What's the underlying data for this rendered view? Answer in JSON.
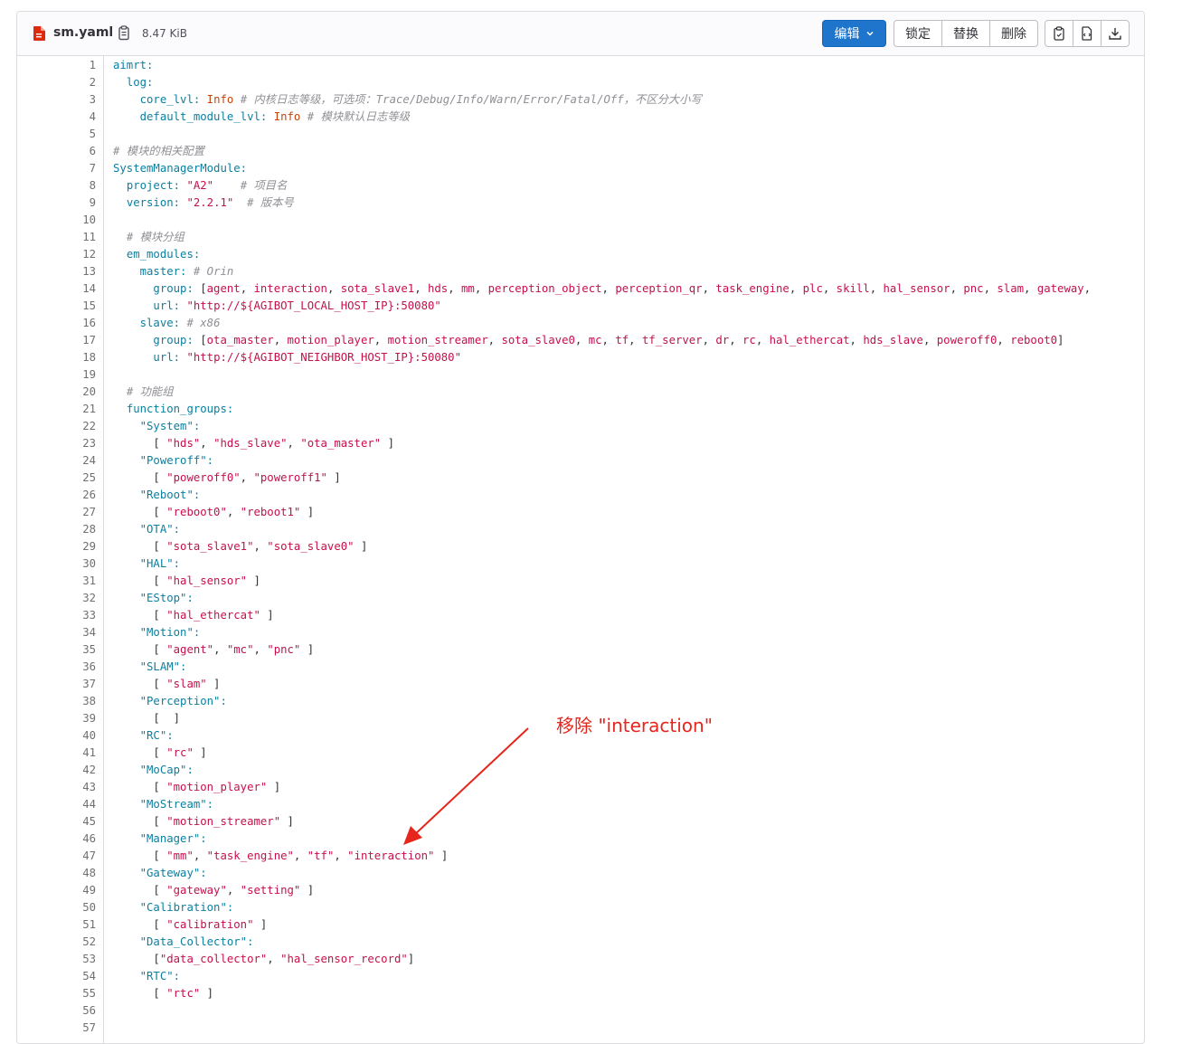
{
  "header": {
    "file_name": "sm.yaml",
    "file_size": "8.47 KiB",
    "file_icon": "yaml-file-icon",
    "copy_icon": "copy-path-icon"
  },
  "toolbar": {
    "edit_label": "编辑",
    "lock_label": "锁定",
    "replace_label": "替换",
    "delete_label": "删除",
    "icons": [
      "copy-contents-icon",
      "open-raw-icon",
      "download-icon"
    ],
    "edit_color": "#1f75cb"
  },
  "code_lines": [
    [
      {
        "t": "aimrt:",
        "c": "k"
      }
    ],
    [
      {
        "t": "  "
      },
      {
        "t": "log:",
        "c": "k"
      }
    ],
    [
      {
        "t": "    "
      },
      {
        "t": "core_lvl:",
        "c": "k"
      },
      {
        "t": " "
      },
      {
        "t": "Info",
        "c": "v"
      },
      {
        "t": " "
      },
      {
        "t": "# 内核日志等级，可选项：Trace/Debug/Info/Warn/Error/Fatal/Off，不区分大小写",
        "c": "c"
      }
    ],
    [
      {
        "t": "    "
      },
      {
        "t": "default_module_lvl:",
        "c": "k"
      },
      {
        "t": " "
      },
      {
        "t": "Info",
        "c": "v"
      },
      {
        "t": " "
      },
      {
        "t": "# 模块默认日志等级",
        "c": "c"
      }
    ],
    [],
    [
      {
        "t": "# 模块的相关配置",
        "c": "c"
      }
    ],
    [
      {
        "t": "SystemManagerModule:",
        "c": "k"
      }
    ],
    [
      {
        "t": "  "
      },
      {
        "t": "project:",
        "c": "k"
      },
      {
        "t": " "
      },
      {
        "t": "\"A2\"",
        "c": "s"
      },
      {
        "t": "    "
      },
      {
        "t": "# 项目名",
        "c": "c"
      }
    ],
    [
      {
        "t": "  "
      },
      {
        "t": "version:",
        "c": "k"
      },
      {
        "t": " "
      },
      {
        "t": "\"2.2.1\"",
        "c": "s"
      },
      {
        "t": "  "
      },
      {
        "t": "# 版本号",
        "c": "c"
      }
    ],
    [],
    [
      {
        "t": "  "
      },
      {
        "t": "# 模块分组",
        "c": "c"
      }
    ],
    [
      {
        "t": "  "
      },
      {
        "t": "em_modules:",
        "c": "k"
      }
    ],
    [
      {
        "t": "    "
      },
      {
        "t": "master:",
        "c": "k"
      },
      {
        "t": " "
      },
      {
        "t": "# Orin",
        "c": "c"
      }
    ],
    [
      {
        "t": "      "
      },
      {
        "t": "group:",
        "c": "k"
      },
      {
        "t": " ["
      },
      {
        "t": "agent",
        "c": "s"
      },
      {
        "t": ", "
      },
      {
        "t": "interaction",
        "c": "s"
      },
      {
        "t": ", "
      },
      {
        "t": "sota_slave1",
        "c": "s"
      },
      {
        "t": ", "
      },
      {
        "t": "hds",
        "c": "s"
      },
      {
        "t": ", "
      },
      {
        "t": "mm",
        "c": "s"
      },
      {
        "t": ", "
      },
      {
        "t": "perception_object",
        "c": "s"
      },
      {
        "t": ", "
      },
      {
        "t": "perception_qr",
        "c": "s"
      },
      {
        "t": ", "
      },
      {
        "t": "task_engine",
        "c": "s"
      },
      {
        "t": ", "
      },
      {
        "t": "plc",
        "c": "s"
      },
      {
        "t": ", "
      },
      {
        "t": "skill",
        "c": "s"
      },
      {
        "t": ", "
      },
      {
        "t": "hal_sensor",
        "c": "s"
      },
      {
        "t": ", "
      },
      {
        "t": "pnc",
        "c": "s"
      },
      {
        "t": ", "
      },
      {
        "t": "slam",
        "c": "s"
      },
      {
        "t": ", "
      },
      {
        "t": "gateway",
        "c": "s"
      },
      {
        "t": ","
      }
    ],
    [
      {
        "t": "      "
      },
      {
        "t": "url:",
        "c": "k"
      },
      {
        "t": " "
      },
      {
        "t": "\"http://${AGIBOT_LOCAL_HOST_IP}:50080\"",
        "c": "s"
      }
    ],
    [
      {
        "t": "    "
      },
      {
        "t": "slave:",
        "c": "k"
      },
      {
        "t": " "
      },
      {
        "t": "# x86",
        "c": "c"
      }
    ],
    [
      {
        "t": "      "
      },
      {
        "t": "group:",
        "c": "k"
      },
      {
        "t": " ["
      },
      {
        "t": "ota_master",
        "c": "s"
      },
      {
        "t": ", "
      },
      {
        "t": "motion_player",
        "c": "s"
      },
      {
        "t": ", "
      },
      {
        "t": "motion_streamer",
        "c": "s"
      },
      {
        "t": ", "
      },
      {
        "t": "sota_slave0",
        "c": "s"
      },
      {
        "t": ", "
      },
      {
        "t": "mc",
        "c": "s"
      },
      {
        "t": ", "
      },
      {
        "t": "tf",
        "c": "s"
      },
      {
        "t": ", "
      },
      {
        "t": "tf_server",
        "c": "s"
      },
      {
        "t": ", "
      },
      {
        "t": "dr",
        "c": "s"
      },
      {
        "t": ", "
      },
      {
        "t": "rc",
        "c": "s"
      },
      {
        "t": ", "
      },
      {
        "t": "hal_ethercat",
        "c": "s"
      },
      {
        "t": ", "
      },
      {
        "t": "hds_slave",
        "c": "s"
      },
      {
        "t": ", "
      },
      {
        "t": "poweroff0",
        "c": "s"
      },
      {
        "t": ", "
      },
      {
        "t": "reboot0",
        "c": "s"
      },
      {
        "t": "]"
      }
    ],
    [
      {
        "t": "      "
      },
      {
        "t": "url:",
        "c": "k"
      },
      {
        "t": " "
      },
      {
        "t": "\"http://${AGIBOT_NEIGHBOR_HOST_IP}:50080\"",
        "c": "s"
      }
    ],
    [],
    [
      {
        "t": "  "
      },
      {
        "t": "# 功能组",
        "c": "c"
      }
    ],
    [
      {
        "t": "  "
      },
      {
        "t": "function_groups:",
        "c": "k"
      }
    ],
    [
      {
        "t": "    "
      },
      {
        "t": "\"System\":",
        "c": "k"
      }
    ],
    [
      {
        "t": "      [ "
      },
      {
        "t": "\"hds\"",
        "c": "s"
      },
      {
        "t": ", "
      },
      {
        "t": "\"hds_slave\"",
        "c": "s"
      },
      {
        "t": ", "
      },
      {
        "t": "\"ota_master\"",
        "c": "s"
      },
      {
        "t": " ]"
      }
    ],
    [
      {
        "t": "    "
      },
      {
        "t": "\"Poweroff\":",
        "c": "k"
      }
    ],
    [
      {
        "t": "      [ "
      },
      {
        "t": "\"poweroff0\"",
        "c": "s"
      },
      {
        "t": ", "
      },
      {
        "t": "\"poweroff1\"",
        "c": "s"
      },
      {
        "t": " ]"
      }
    ],
    [
      {
        "t": "    "
      },
      {
        "t": "\"Reboot\":",
        "c": "k"
      }
    ],
    [
      {
        "t": "      [ "
      },
      {
        "t": "\"reboot0\"",
        "c": "s"
      },
      {
        "t": ", "
      },
      {
        "t": "\"reboot1\"",
        "c": "s"
      },
      {
        "t": " ]"
      }
    ],
    [
      {
        "t": "    "
      },
      {
        "t": "\"OTA\":",
        "c": "k"
      }
    ],
    [
      {
        "t": "      [ "
      },
      {
        "t": "\"sota_slave1\"",
        "c": "s"
      },
      {
        "t": ", "
      },
      {
        "t": "\"sota_slave0\"",
        "c": "s"
      },
      {
        "t": " ]"
      }
    ],
    [
      {
        "t": "    "
      },
      {
        "t": "\"HAL\":",
        "c": "k"
      }
    ],
    [
      {
        "t": "      [ "
      },
      {
        "t": "\"hal_sensor\"",
        "c": "s"
      },
      {
        "t": " ]"
      }
    ],
    [
      {
        "t": "    "
      },
      {
        "t": "\"EStop\":",
        "c": "k"
      }
    ],
    [
      {
        "t": "      [ "
      },
      {
        "t": "\"hal_ethercat\"",
        "c": "s"
      },
      {
        "t": " ]"
      }
    ],
    [
      {
        "t": "    "
      },
      {
        "t": "\"Motion\":",
        "c": "k"
      }
    ],
    [
      {
        "t": "      [ "
      },
      {
        "t": "\"agent\"",
        "c": "s"
      },
      {
        "t": ", "
      },
      {
        "t": "\"mc\"",
        "c": "s"
      },
      {
        "t": ", "
      },
      {
        "t": "\"pnc\"",
        "c": "s"
      },
      {
        "t": " ]"
      }
    ],
    [
      {
        "t": "    "
      },
      {
        "t": "\"SLAM\":",
        "c": "k"
      }
    ],
    [
      {
        "t": "      [ "
      },
      {
        "t": "\"slam\"",
        "c": "s"
      },
      {
        "t": " ]"
      }
    ],
    [
      {
        "t": "    "
      },
      {
        "t": "\"Perception\":",
        "c": "k"
      }
    ],
    [
      {
        "t": "      [  ]"
      }
    ],
    [
      {
        "t": "    "
      },
      {
        "t": "\"RC\":",
        "c": "k"
      }
    ],
    [
      {
        "t": "      [ "
      },
      {
        "t": "\"rc\"",
        "c": "s"
      },
      {
        "t": " ]"
      }
    ],
    [
      {
        "t": "    "
      },
      {
        "t": "\"MoCap\":",
        "c": "k"
      }
    ],
    [
      {
        "t": "      [ "
      },
      {
        "t": "\"motion_player\"",
        "c": "s"
      },
      {
        "t": " ]"
      }
    ],
    [
      {
        "t": "    "
      },
      {
        "t": "\"MoStream\":",
        "c": "k"
      }
    ],
    [
      {
        "t": "      [ "
      },
      {
        "t": "\"motion_streamer\"",
        "c": "s"
      },
      {
        "t": " ]"
      }
    ],
    [
      {
        "t": "    "
      },
      {
        "t": "\"Manager\":",
        "c": "k"
      }
    ],
    [
      {
        "t": "      [ "
      },
      {
        "t": "\"mm\"",
        "c": "s"
      },
      {
        "t": ", "
      },
      {
        "t": "\"task_engine\"",
        "c": "s"
      },
      {
        "t": ", "
      },
      {
        "t": "\"tf\"",
        "c": "s"
      },
      {
        "t": ", "
      },
      {
        "t": "\"interaction\"",
        "c": "s"
      },
      {
        "t": " ]"
      }
    ],
    [
      {
        "t": "    "
      },
      {
        "t": "\"Gateway\":",
        "c": "k"
      }
    ],
    [
      {
        "t": "      [ "
      },
      {
        "t": "\"gateway\"",
        "c": "s"
      },
      {
        "t": ", "
      },
      {
        "t": "\"setting\"",
        "c": "s"
      },
      {
        "t": " ]"
      }
    ],
    [
      {
        "t": "    "
      },
      {
        "t": "\"Calibration\":",
        "c": "k"
      }
    ],
    [
      {
        "t": "      [ "
      },
      {
        "t": "\"calibration\"",
        "c": "s"
      },
      {
        "t": " ]"
      }
    ],
    [
      {
        "t": "    "
      },
      {
        "t": "\"Data_Collector\":",
        "c": "k"
      }
    ],
    [
      {
        "t": "      ["
      },
      {
        "t": "\"data_collector\"",
        "c": "s"
      },
      {
        "t": ", "
      },
      {
        "t": "\"hal_sensor_record\"",
        "c": "s"
      },
      {
        "t": "]"
      }
    ],
    [
      {
        "t": "    "
      },
      {
        "t": "\"RTC\":",
        "c": "k"
      }
    ],
    [
      {
        "t": "      [ "
      },
      {
        "t": "\"rtc\"",
        "c": "s"
      },
      {
        "t": " ]"
      }
    ],
    [],
    []
  ],
  "annotation": {
    "text": "移除 \"interaction\"",
    "color": "#e6251c"
  }
}
